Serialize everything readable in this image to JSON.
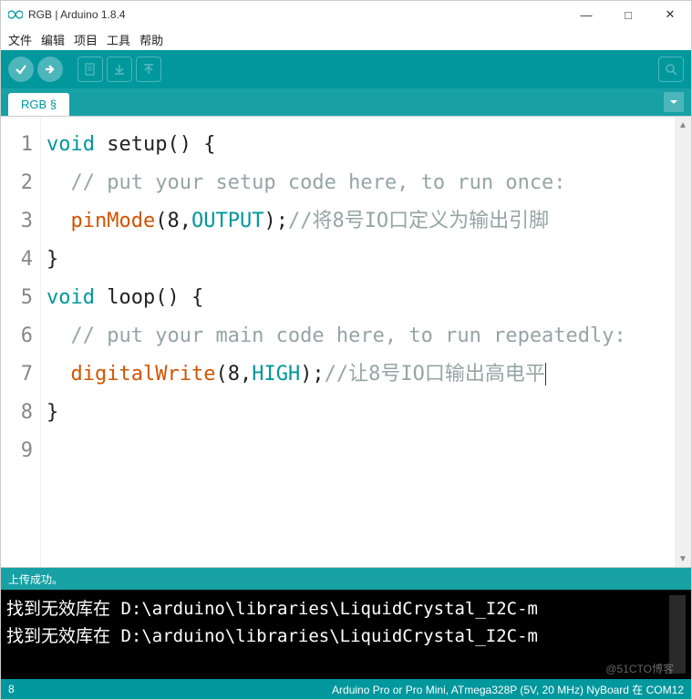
{
  "window": {
    "title": "RGB | Arduino 1.8.4",
    "minimize": "—",
    "maximize": "□",
    "close": "✕"
  },
  "menu": {
    "file": "文件",
    "edit": "编辑",
    "sketch": "项目",
    "tools": "工具",
    "help": "帮助"
  },
  "toolbar": {
    "verify": "✔",
    "upload": "→",
    "new": "new",
    "open": "open",
    "save": "save",
    "serial": "serial"
  },
  "tabs": {
    "active": "RGB §",
    "menu": "▼"
  },
  "editor": {
    "line_numbers": [
      "1",
      "2",
      "3",
      "4",
      "5",
      "6",
      "7",
      "8",
      "9"
    ],
    "lines": [
      [
        {
          "t": "void",
          "c": "kw"
        },
        {
          "t": " setup() {",
          "c": ""
        }
      ],
      [
        {
          "t": "  ",
          "c": ""
        },
        {
          "t": "// put your setup code here, to run once:",
          "c": "cmt"
        }
      ],
      [
        {
          "t": "  ",
          "c": ""
        },
        {
          "t": "pinMode",
          "c": "fn"
        },
        {
          "t": "(8,",
          "c": ""
        },
        {
          "t": "OUTPUT",
          "c": "const"
        },
        {
          "t": ");",
          "c": ""
        },
        {
          "t": "//将8号IO口定义为输出引脚",
          "c": "cmt"
        }
      ],
      [
        {
          "t": "}",
          "c": ""
        }
      ],
      [
        {
          "t": "",
          "c": ""
        }
      ],
      [
        {
          "t": "void",
          "c": "kw"
        },
        {
          "t": " loop() {",
          "c": ""
        }
      ],
      [
        {
          "t": "  ",
          "c": ""
        },
        {
          "t": "// put your main code here, to run repeatedly:",
          "c": "cmt"
        }
      ],
      [
        {
          "t": "  ",
          "c": ""
        },
        {
          "t": "digitalWrite",
          "c": "fn"
        },
        {
          "t": "(8,",
          "c": ""
        },
        {
          "t": "HIGH",
          "c": "const"
        },
        {
          "t": ");",
          "c": ""
        },
        {
          "t": "//让8号IO口输出高电平",
          "c": "cmt"
        },
        {
          "t": "",
          "c": "cursor"
        }
      ],
      [
        {
          "t": "}",
          "c": ""
        }
      ]
    ]
  },
  "status_msg": "上传成功。",
  "console": {
    "lines": [
      "找到无效库在 D:\\arduino\\libraries\\LiquidCrystal_I2C-m",
      "找到无效库在 D:\\arduino\\libraries\\LiquidCrystal_I2C-m"
    ]
  },
  "status_bar": {
    "line": "8",
    "board": "Arduino Pro or Pro Mini, ATmega328P (5V, 20 MHz) NyBoard 在 COM12"
  },
  "watermark": "@51CTO博客"
}
